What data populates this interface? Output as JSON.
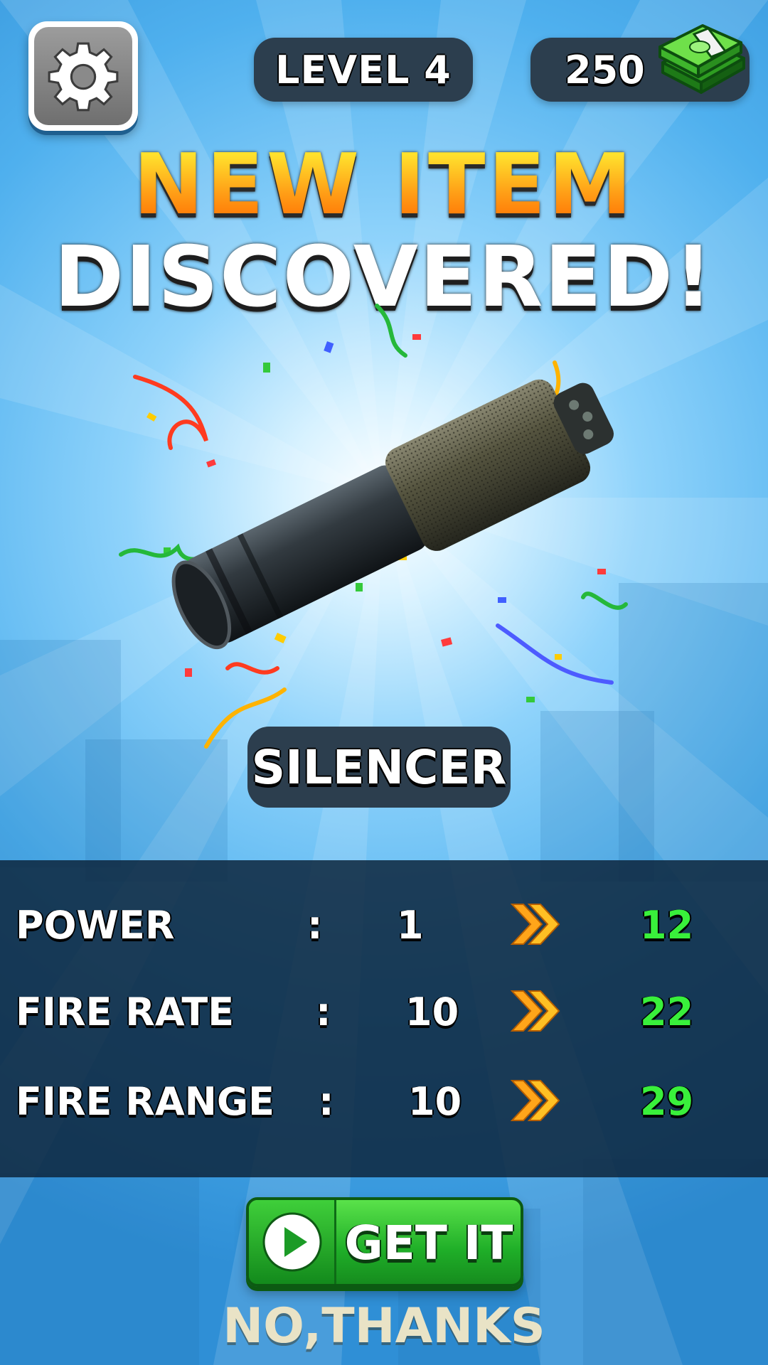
{
  "header": {
    "level_label": "LEVEL 4",
    "cash_value": "250",
    "settings_icon": "gear-icon",
    "cash_icon": "money-stack-icon"
  },
  "title": {
    "line1": "NEW ITEM",
    "line2": "DISCOVERED!"
  },
  "item": {
    "name": "SILENCER",
    "image_icon": "silencer-image"
  },
  "stats": [
    {
      "label": "POWER",
      "separator": ":",
      "current": "1",
      "upgraded": "12"
    },
    {
      "label": "FIRE RATE",
      "separator": ":",
      "current": "10",
      "upgraded": "22"
    },
    {
      "label": "FIRE RANGE",
      "separator": ":",
      "current": "10",
      "upgraded": "29"
    }
  ],
  "actions": {
    "get_it_label": "GET IT",
    "get_it_icon": "play-icon",
    "no_thanks_label": "NO,THANKS"
  },
  "colors": {
    "title_orange": "#ff9d16",
    "stat_new_green": "#39f03b",
    "button_green": "#1fae28",
    "panel_navy": "#0e263e"
  }
}
